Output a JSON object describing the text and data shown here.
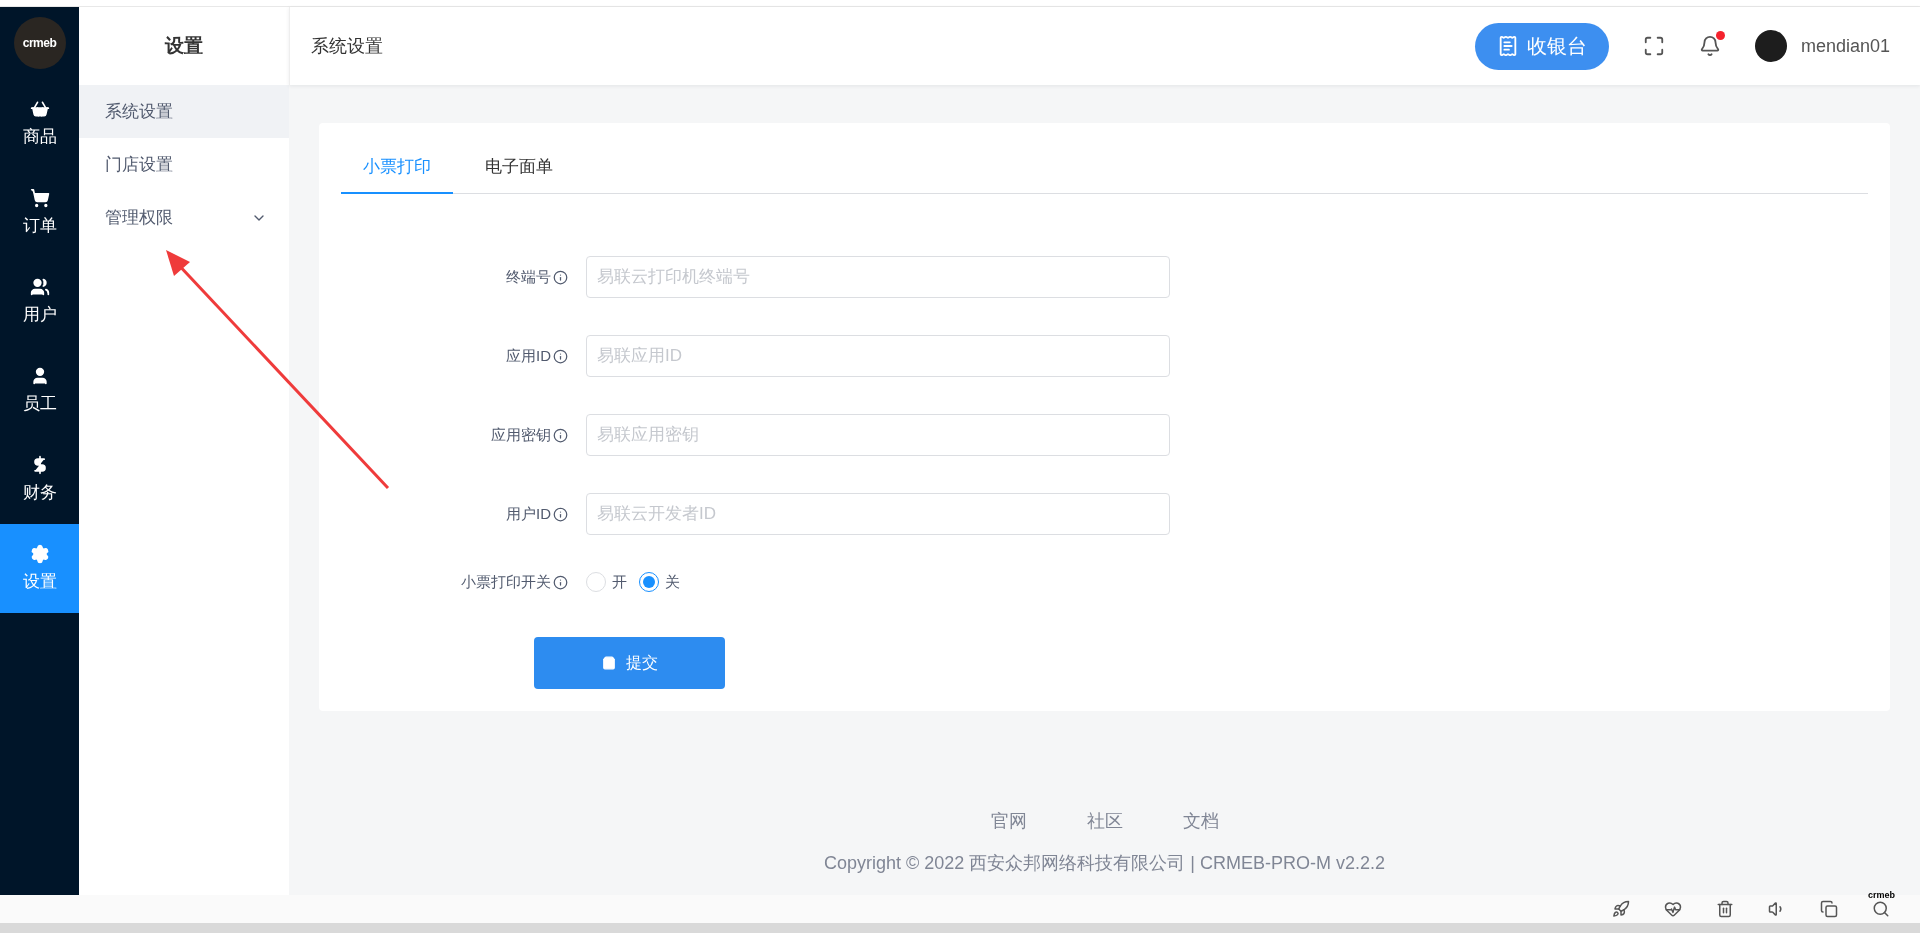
{
  "logo": {
    "text": "crmeb"
  },
  "nav": [
    {
      "label": "商品",
      "kind": "basket",
      "selected": false
    },
    {
      "label": "订单",
      "kind": "cart",
      "selected": false
    },
    {
      "label": "用户",
      "kind": "users",
      "selected": false
    },
    {
      "label": "员工",
      "kind": "person",
      "selected": false
    },
    {
      "label": "财务",
      "kind": "dollar",
      "selected": false
    },
    {
      "label": "设置",
      "kind": "gear",
      "selected": true
    }
  ],
  "submenu": {
    "title": "设置",
    "items": [
      {
        "label": "系统设置",
        "selected": true,
        "expandable": false
      },
      {
        "label": "门店设置",
        "selected": false,
        "expandable": false
      },
      {
        "label": "管理权限",
        "selected": false,
        "expandable": true
      }
    ]
  },
  "header": {
    "title": "系统设置",
    "cashier_button": "收银台",
    "notification_dot": true,
    "username": "mendian01"
  },
  "tabs": [
    {
      "label": "小票打印",
      "selected": true
    },
    {
      "label": "电子面单",
      "selected": false
    }
  ],
  "form": {
    "fields": [
      {
        "label": "终端号",
        "placeholder": "易联云打印机终端号"
      },
      {
        "label": "应用ID",
        "placeholder": "易联应用ID"
      },
      {
        "label": "应用密钥",
        "placeholder": "易联应用密钥"
      },
      {
        "label": "用户ID",
        "placeholder": "易联云开发者ID"
      }
    ],
    "switch": {
      "label": "小票打印开关",
      "options": [
        {
          "label": "开",
          "selected": false
        },
        {
          "label": "关",
          "selected": true
        }
      ]
    },
    "submit": "提交"
  },
  "footer": {
    "links": [
      "官网",
      "社区",
      "文档"
    ],
    "copyright": "Copyright © 2022 西安众邦网络科技有限公司 | CRMEB-PRO-M v2.2.2"
  },
  "taskbar": {
    "logo_text": "crmeb"
  }
}
